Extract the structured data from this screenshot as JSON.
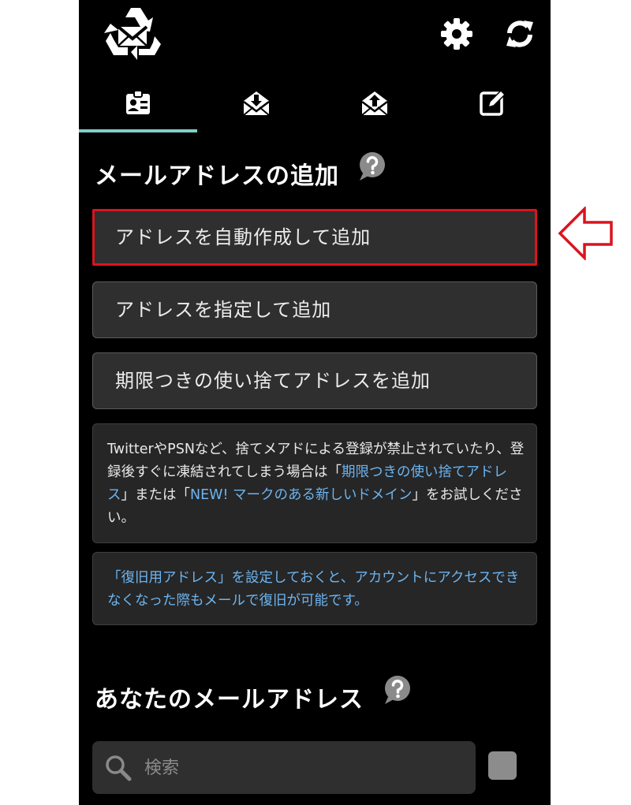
{
  "icons": {
    "logo": "recycle-mail-logo-icon",
    "settings": "gear-icon",
    "refresh": "sync-icon",
    "tab1": "id-card-icon",
    "tab2": "mail-download-icon",
    "tab3": "mail-upload-icon",
    "tab4": "compose-icon",
    "help": "question-bubble-icon",
    "search": "search-icon",
    "pointer": "left-arrow-icon"
  },
  "colors": {
    "background": "#000000",
    "accent": "#7fcfc8",
    "link": "#6cb4f0",
    "highlight": "#d9141e"
  },
  "add_section": {
    "title": "メールアドレスの追加",
    "buttons": [
      {
        "label": "アドレスを自動作成して追加"
      },
      {
        "label": "アドレスを指定して追加"
      },
      {
        "label": "期限つきの使い捨てアドレスを追加"
      }
    ]
  },
  "info1": {
    "text_a": "TwitterやPSNなど、捨てメアドによる登録が禁止されていたり、登録後すぐに凍結されてしまう場合は「",
    "link_a": "期限つきの使い捨てアドレス",
    "text_b": "」または「",
    "link_b": "NEW! マークのある新しいドメイン",
    "text_c": "」をお試しください。"
  },
  "info2": {
    "link": "「復旧用アドレス」",
    "text": "を設定しておくと、アカウントにアクセスできなくなった際もメールで復旧が可能です。"
  },
  "your_section": {
    "title": "あなたのメールアドレス",
    "search_placeholder": "検索"
  }
}
